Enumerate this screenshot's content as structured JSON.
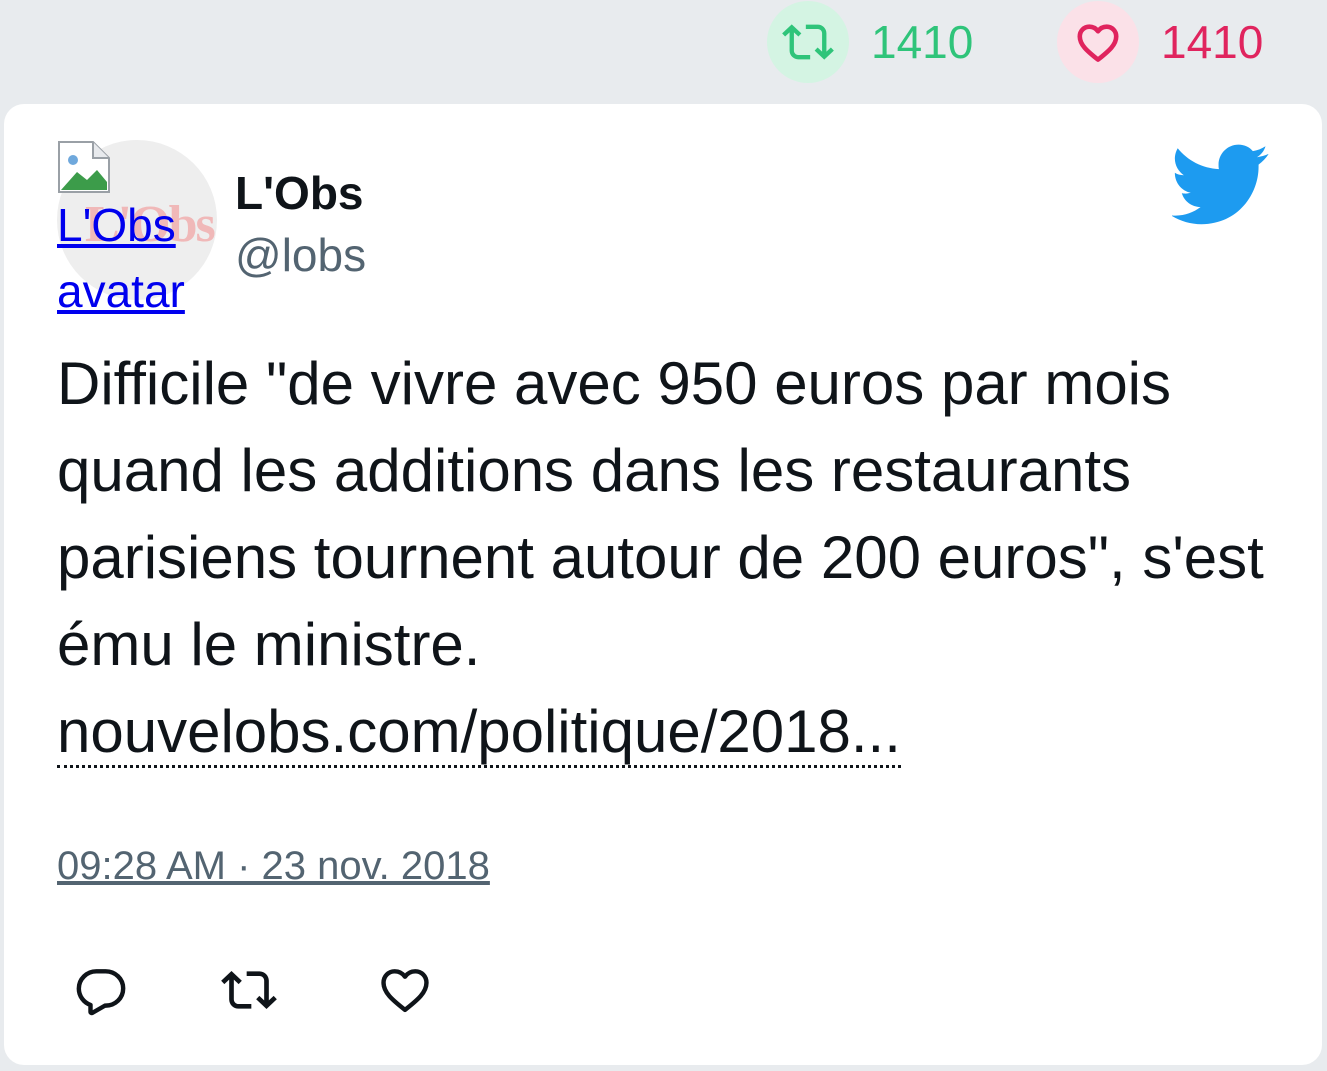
{
  "stats": {
    "retweets": "1410",
    "likes": "1410",
    "retweet_color": "#2fc47a",
    "like_color": "#e0245e"
  },
  "tweet": {
    "avatar_alt": "L'Obs avatar",
    "avatar_logo_text": "L'Obs",
    "author_name": "L'Obs",
    "author_handle": "@lobs",
    "text": "Difficile \"de vivre avec 950 euros par mois quand les additions dans les restaurants parisiens tournent autour de 200 euros\", s'est ému le ministre. ",
    "link_text": "nouvelobs.com/politique/2018...",
    "timestamp": "09:28 AM · 23 nov. 2018"
  },
  "icons": {
    "stat_retweet": "retweet-icon",
    "stat_like": "heart-icon",
    "platform": "twitter-bird-icon",
    "reply": "reply-icon",
    "retweet": "retweet-icon",
    "like": "heart-icon"
  }
}
